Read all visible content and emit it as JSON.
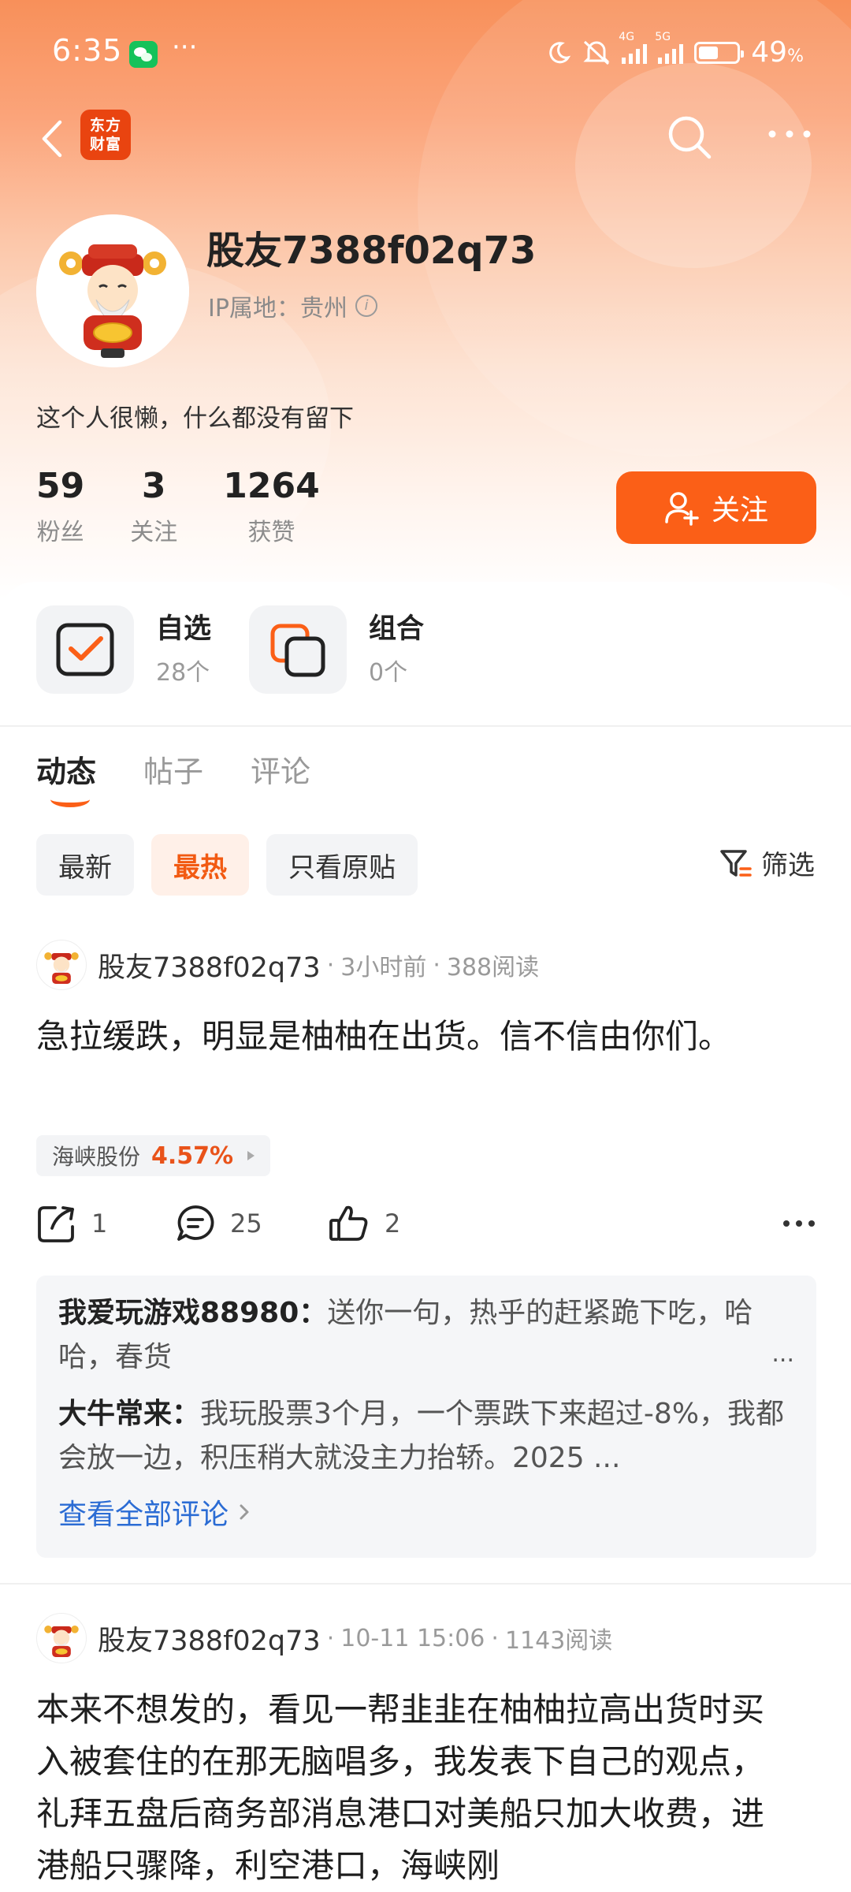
{
  "status_bar": {
    "time": "6:35",
    "battery_pct": "49",
    "battery_unit": "%",
    "net1": "4G",
    "net2": "5G",
    "dots": "···"
  },
  "nav": {
    "logo_line1": "东方",
    "logo_line2": "财富"
  },
  "profile": {
    "username": "股友7388f02q73",
    "ip_label": "IP属地：贵州",
    "bio": "这个人很懒，什么都没有留下",
    "stats": [
      {
        "value": "59",
        "label": "粉丝"
      },
      {
        "value": "3",
        "label": "关注"
      },
      {
        "value": "1264",
        "label": "获赞"
      }
    ],
    "follow_label": "关注"
  },
  "shortcuts": [
    {
      "title": "自选",
      "sub": "28个"
    },
    {
      "title": "组合",
      "sub": "0个"
    }
  ],
  "tabs": [
    "动态",
    "帖子",
    "评论"
  ],
  "filters": [
    "最新",
    "最热",
    "只看原贴"
  ],
  "filter_button": "筛选",
  "posts": [
    {
      "author": "股友7388f02q73",
      "time": "3小时前",
      "reads": "388阅读",
      "text": "急拉缓跌，明显是柚柚在出货。信不信由你们。",
      "stock_name": "海峡股份",
      "stock_pct": "4.57%",
      "shares": "1",
      "comments": "25",
      "likes": "2",
      "replies": [
        {
          "user": "我爱玩游戏88980：",
          "text": "送你一句，热乎的赶紧跪下吃，哈哈，春货",
          "ellipsis": "..."
        },
        {
          "user": "大牛常来：",
          "text": "我玩股票3个月，一个票跌下来超过-8%，我都会放一边，积压稍大就没主力抬轿。2025 ..."
        }
      ],
      "view_all": "查看全部评论"
    },
    {
      "author": "股友7388f02q73",
      "time": "10-11 15:06",
      "reads": "1143阅读",
      "text": "本来不想发的，看见一帮韭韭在柚柚拉高出货时买入被套住的在那无脑唱多，我发表下自己的观点，礼拜五盘后商务部消息港口对美船只加大收费，进港船只骤降，利空港口，海峡刚"
    }
  ],
  "colors": {
    "accent": "#fb5f17",
    "link": "#2b6cd4",
    "stock_up": "#e9531a"
  }
}
